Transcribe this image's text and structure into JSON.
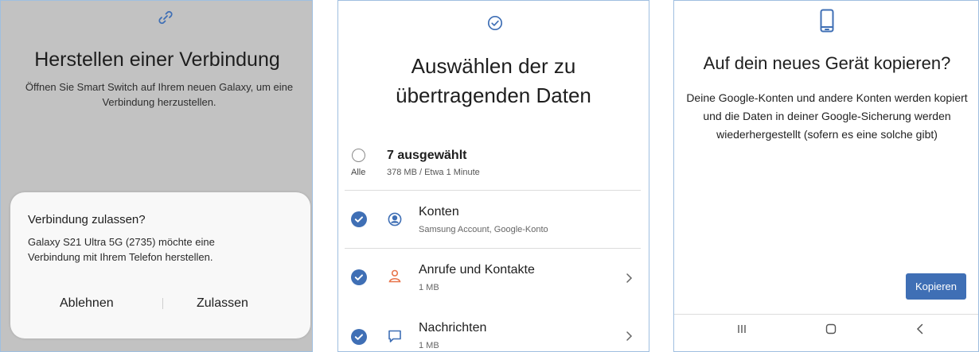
{
  "colors": {
    "accent": "#3f6fb5",
    "overlay": "#c2c2c2",
    "dialog": "#f8f8f8"
  },
  "panel1": {
    "icon": "link-icon",
    "title": "Herstellen einer Verbindung",
    "subtitle": "Öffnen Sie Smart Switch auf Ihrem neuen Galaxy, um eine Verbindung herzustellen.",
    "dialog": {
      "title": "Verbindung zulassen?",
      "message": "Galaxy S21 Ultra 5G (2735) möchte eine Verbindung mit Ihrem Telefon herstellen.",
      "deny_label": "Ablehnen",
      "allow_label": "Zulassen"
    }
  },
  "panel2": {
    "icon": "check-circle-icon",
    "title_line1": "Auswählen der zu",
    "title_line2": "übertragenden Daten",
    "select_all_label": "Alle",
    "summary_title": "7 ausgewählt",
    "summary_sub": "378 MB / Etwa 1 Minute",
    "items": [
      {
        "label": "Konten",
        "sub": "Samsung Account, Google-Konto",
        "icon": "account-icon",
        "checked": true
      },
      {
        "label": "Anrufe und Kontakte",
        "sub": "1 MB",
        "icon": "contact-icon",
        "checked": true
      },
      {
        "label": "Nachrichten",
        "sub": "1 MB",
        "icon": "message-icon",
        "checked": true
      }
    ]
  },
  "panel3": {
    "icon": "phone-icon",
    "title": "Auf dein neues Gerät kopieren?",
    "body": "Deine Google-Konten und andere Konten werden kopiert und die Daten in deiner Google-Sicherung werden wiederhergestellt (sofern es eine solche gibt)",
    "copy_label": "Kopieren",
    "nav": [
      "recents-icon",
      "home-icon",
      "back-icon"
    ]
  }
}
